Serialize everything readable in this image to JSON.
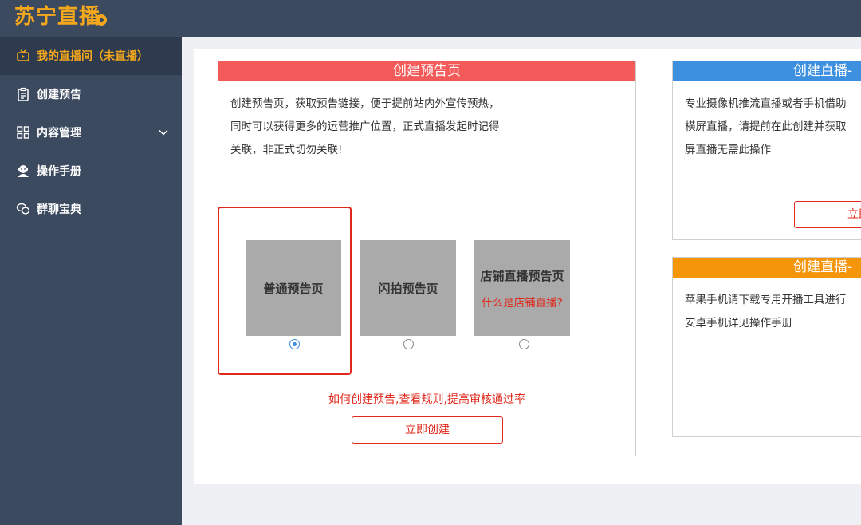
{
  "header": {
    "logo_text": "苏宁直播"
  },
  "sidebar": {
    "items": [
      {
        "label": "我的直播间（未直播）",
        "icon": "tv-icon",
        "active": true
      },
      {
        "label": "创建预告",
        "icon": "clipboard-icon"
      },
      {
        "label": "内容管理",
        "icon": "grid-icon",
        "expandable": true
      },
      {
        "label": "操作手册",
        "icon": "user-manual-icon"
      },
      {
        "label": "群聊宝典",
        "icon": "chat-icon"
      }
    ]
  },
  "preview_card": {
    "title": "创建预告页",
    "lines": [
      "创建预告页，获取预告链接，便于提前站内外宣传预热，",
      "同时可以获得更多的运营推广位置，正式直播发起时记得",
      "关联，非正式切勿关联!"
    ],
    "templates": [
      {
        "title": "普通预告页",
        "selected": true
      },
      {
        "title": "闪拍预告页",
        "selected": false
      },
      {
        "title": "店铺直播预告页",
        "link": "什么是店铺直播?",
        "selected": false
      }
    ],
    "rules_link": "如何创建预告,查看规则,提高审核通过率",
    "create_button": "立即创建"
  },
  "live_card_1": {
    "title": "创建直播-",
    "lines": [
      "专业摄像机推流直播或者手机借助",
      "横屏直播，请提前在此创建并获取",
      "屏直播无需此操作"
    ],
    "create_button": "立即"
  },
  "live_card_2": {
    "title": "创建直播-",
    "lines": [
      "苹果手机请下载专用开播工具进行",
      "安卓手机详见操作手册"
    ]
  },
  "colors": {
    "sidebar_bg": "#3c4a60",
    "accent_orange": "#f5a81c",
    "red": "#e0281b",
    "blue": "#3d8fe0",
    "orange": "#f5950a"
  }
}
